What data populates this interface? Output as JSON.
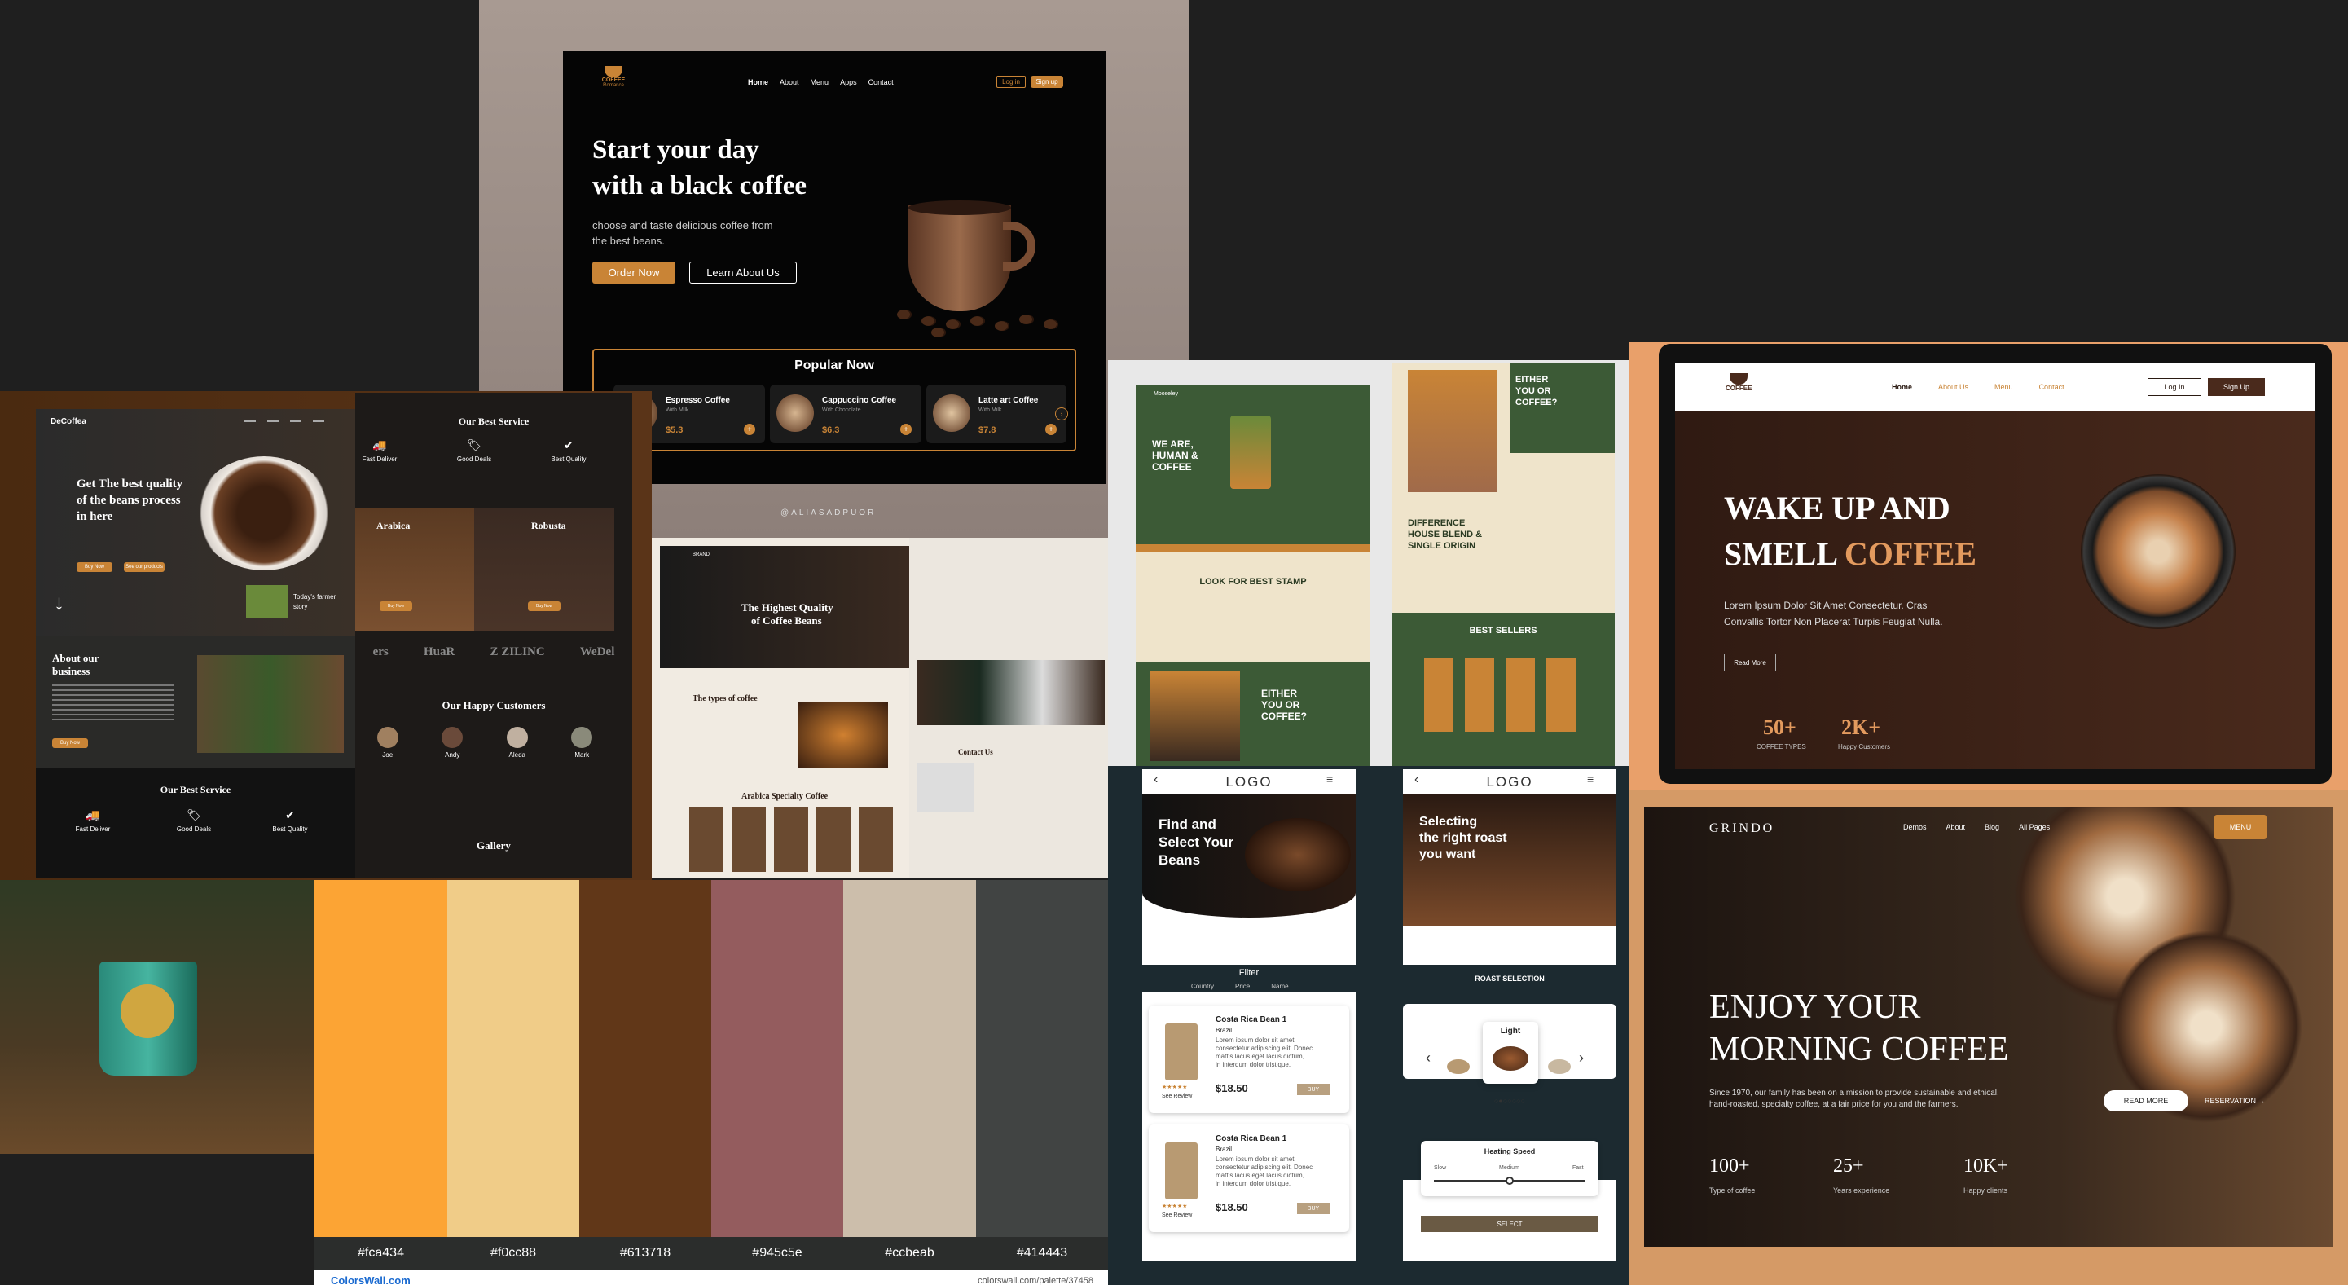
{
  "romance": {
    "logo_text": "COFFEE",
    "logo_sub": "Romance",
    "nav": [
      "Home",
      "About",
      "Menu",
      "Apps",
      "Contact"
    ],
    "login": "Log in",
    "signup": "Sign up",
    "headline_1": "Start your day",
    "headline_2": "with a black coffee",
    "sub_1": "choose and taste delicious coffee from",
    "sub_2": "the best beans.",
    "order_btn": "Order Now",
    "learn_btn": "Learn About Us",
    "popular_title": "Popular Now",
    "products": [
      {
        "name": "Espresso Coffee",
        "sub": "With Milk",
        "price": "$5.3"
      },
      {
        "name": "Cappuccino Coffee",
        "sub": "With Chocolate",
        "price": "$6.3"
      },
      {
        "name": "Latte art Coffee",
        "sub": "With Milk",
        "price": "$7.8"
      }
    ],
    "credit": "@ALIASADPUOR"
  },
  "decoffea": {
    "brand": "DeCoffea",
    "hero_1": "Get The best quality",
    "hero_2": "of the beans process",
    "hero_3": "in here",
    "btn_buy": "Buy Now",
    "btn_more": "See our products",
    "farmer_story_1": "Today's farmer",
    "farmer_story_2": "story",
    "about_1": "About our",
    "about_2": "business",
    "about_btn": "Buy Now",
    "service_title": "Our Best Service",
    "services": [
      "Fast Deliver",
      "Good Deals",
      "Best Quality"
    ],
    "service_title_2": "Our Best Service",
    "varieties": [
      "Arabica",
      "Robusta"
    ],
    "variety_btn": "Buy Now",
    "partners": [
      "ers",
      "HuaR",
      "Z ZILINC",
      "WeDel"
    ],
    "customers_title": "Our Happy Customers",
    "customers": [
      "Joe",
      "Andy",
      "Aleda",
      "Mark"
    ],
    "gallery_title": "Gallery"
  },
  "beans_site": {
    "brand": "BRAND",
    "hero_1": "The Highest Quality",
    "hero_2": "of Coffee Beans",
    "types_title": "The types of coffee",
    "arabica_title": "Arabica Specialty Coffee",
    "contact_title": "Contact Us"
  },
  "green_site": {
    "brand": "Mooseley",
    "hero_1": "WE ARE,",
    "hero_2": "HUMAN &",
    "hero_3": "COFFEE",
    "either_1": "EITHER",
    "either_2": "YOU OR",
    "either_3": "COFFEE?",
    "difference_1": "DIFFERENCE",
    "difference_2": "HOUSE BLEND &",
    "difference_3": "SINGLE ORIGIN",
    "stamp_title": "LOOK FOR BEST STAMP",
    "best_sellers": "BEST SELLERS",
    "either_b_1": "EITHER",
    "either_b_2": "YOU OR",
    "either_b_3": "COFFEE?"
  },
  "wake_up": {
    "logo": "COFFEE",
    "nav": [
      "Home",
      "About Us",
      "Menu",
      "Contact"
    ],
    "login": "Log In",
    "signup": "Sign Up",
    "headline_1": "WAKE UP AND",
    "headline_2a": "SMELL ",
    "headline_2b": "COFFEE",
    "body_1": "Lorem Ipsum Dolor Sit Amet Consectetur. Cras",
    "body_2": "Convallis Tortor Non Placerat Turpis Feugiat Nulla.",
    "read_more": "Read More",
    "stat_1_value": "50+",
    "stat_1_label": "COFFEE TYPES",
    "stat_2_value": "2K+",
    "stat_2_label": "Happy Customers"
  },
  "palette": {
    "colors": [
      "#fca434",
      "#f0cc88",
      "#613718",
      "#945c5e",
      "#ccbeab",
      "#414443"
    ],
    "site": "ColorsWall.com",
    "url": "colorswall.com/palette/37458"
  },
  "mobile_left": {
    "logo": "LOGO",
    "hero_1": "Find and",
    "hero_2": "Select Your",
    "hero_3": "Beans",
    "filter_title": "Filter",
    "filters": [
      "Country",
      "Price",
      "Name"
    ],
    "items": [
      {
        "name": "Costa Rica Bean 1",
        "origin": "Brazil",
        "desc_1": "Lorem ipsum dolor sit amet,",
        "desc_2": "consectetur adipiscing elit. Donec",
        "desc_3": "mattis lacus eget lacus dictum,",
        "desc_4": "in interdum dolor tristique.",
        "review": "See Review",
        "price": "$18.50",
        "buy": "BUY"
      },
      {
        "name": "Costa Rica Bean 1",
        "origin": "Brazil",
        "desc_1": "Lorem ipsum dolor sit amet,",
        "desc_2": "consectetur adipiscing elit. Donec",
        "desc_3": "mattis lacus eget lacus dictum,",
        "desc_4": "in interdum dolor tristique.",
        "review": "See Review",
        "price": "$18.50",
        "buy": "BUY"
      }
    ]
  },
  "mobile_right": {
    "logo": "LOGO",
    "hero_1": "Selecting",
    "hero_2": "the right roast",
    "hero_3": "you want",
    "roast_title": "ROAST SELECTION",
    "roast_selected": "Light",
    "heating_title": "Heating Speed",
    "heating_labels": [
      "Slow",
      "Medium",
      "Fast"
    ],
    "select_btn": "SELECT"
  },
  "grindo": {
    "brand": "GRINDO",
    "nav": [
      "Demos",
      "About",
      "Blog",
      "All Pages"
    ],
    "menu_btn": "MENU",
    "headline_1": "ENJOY YOUR",
    "headline_2": "MORNING COFFEE",
    "body_1": "Since 1970, our family has been on a mission to provide sustainable and ethical,",
    "body_2": "hand-roasted, specialty coffee, at a fair price for you and the farmers.",
    "read_more": "READ MORE",
    "reservation": "RESERVATION →",
    "stats": [
      {
        "value": "100+",
        "label": "Type of coffee"
      },
      {
        "value": "25+",
        "label": "Years experience"
      },
      {
        "value": "10K+",
        "label": "Happy clients"
      }
    ]
  },
  "colors": {
    "accent": "#c98436",
    "dark_bg": "#1f1f1f",
    "green": "#3c5a36",
    "cream": "#efe4cb"
  }
}
